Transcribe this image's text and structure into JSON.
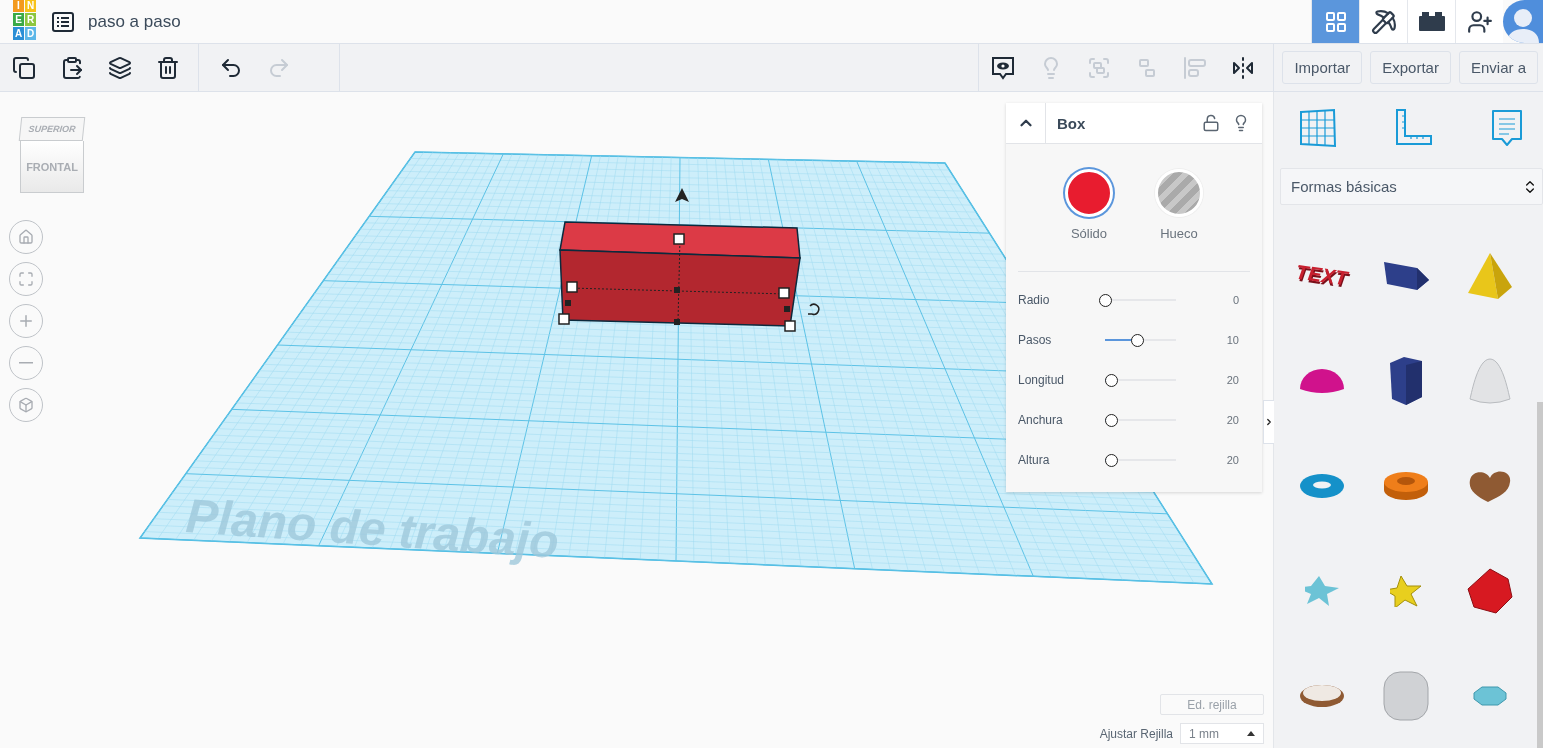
{
  "logo": {
    "letters": [
      {
        "char": "I",
        "color": "#f39a1e"
      },
      {
        "char": "N",
        "color": "#f7c21a"
      },
      {
        "char": "E",
        "color": "#3aaa47"
      },
      {
        "char": "R",
        "color": "#8dc63f"
      },
      {
        "char": "A",
        "color": "#2a8fd6"
      },
      {
        "char": "D",
        "color": "#5db7e8"
      }
    ]
  },
  "design_title": "paso a paso",
  "top_nav": [
    {
      "kind": "grid",
      "selected": true
    },
    {
      "kind": "pickaxe",
      "selected": false
    },
    {
      "kind": "bricks",
      "selected": false
    },
    {
      "kind": "add-user",
      "selected": false
    }
  ],
  "edit_tools": [
    {
      "kind": "copy",
      "disabled": false
    },
    {
      "kind": "paste",
      "disabled": false
    },
    {
      "kind": "duplicate",
      "disabled": false
    },
    {
      "kind": "delete",
      "disabled": false
    }
  ],
  "history_tools": [
    {
      "kind": "undo",
      "disabled": false
    },
    {
      "kind": "redo",
      "disabled": true
    }
  ],
  "view_tools": [
    {
      "kind": "notes",
      "disabled": false
    },
    {
      "kind": "light",
      "disabled": true
    },
    {
      "kind": "group",
      "disabled": true
    },
    {
      "kind": "ungroup",
      "disabled": true
    },
    {
      "kind": "align",
      "disabled": true
    },
    {
      "kind": "mirror",
      "disabled": false
    }
  ],
  "action_buttons": [
    "Importar",
    "Exportar",
    "Enviar a"
  ],
  "view_cube": {
    "top": "SUPERIOR",
    "front": "FRONTAL"
  },
  "nav_controls": [
    {
      "kind": "home"
    },
    {
      "kind": "fit"
    },
    {
      "kind": "zoom-in"
    },
    {
      "kind": "zoom-out"
    },
    {
      "kind": "perspective"
    }
  ],
  "workplane": {
    "label": "Plano de trabajo"
  },
  "inspector": {
    "title": "Box",
    "expanded": true,
    "locked": false,
    "materials": [
      {
        "kind": "solid",
        "label": "Sólido",
        "selected": true
      },
      {
        "kind": "hole",
        "label": "Hueco",
        "selected": false
      }
    ],
    "params": [
      {
        "name": "Radio",
        "level": 0,
        "reading": "0"
      },
      {
        "name": "Pasos",
        "level": 0.45,
        "reading": "10"
      },
      {
        "name": "Longitud",
        "level": 0.08,
        "reading": "20"
      },
      {
        "name": "Anchura",
        "level": 0.08,
        "reading": "20"
      },
      {
        "name": "Altura",
        "level": 0.08,
        "reading": "20"
      }
    ]
  },
  "grid_controls": {
    "edit_button": "Ed. rejilla",
    "snap_label": "Ajustar Rejilla",
    "snap_value": "1 mm"
  },
  "library": {
    "tabs": [
      {
        "kind": "grid",
        "selected": false
      },
      {
        "kind": "ruler",
        "selected": false
      },
      {
        "kind": "notes",
        "selected": false
      }
    ],
    "category": "Formas básicas",
    "shapes": [
      {
        "kind": "text",
        "label": "TEXT"
      },
      {
        "kind": "roof"
      },
      {
        "kind": "pyramid"
      },
      {
        "kind": "half-sphere"
      },
      {
        "kind": "polygon"
      },
      {
        "kind": "paraboloid"
      },
      {
        "kind": "torus"
      },
      {
        "kind": "tube"
      },
      {
        "kind": "heart"
      },
      {
        "kind": "star-flat"
      },
      {
        "kind": "star"
      },
      {
        "kind": "icosahedron"
      },
      {
        "kind": "ring"
      },
      {
        "kind": "rounded-cube"
      },
      {
        "kind": "gem"
      }
    ]
  }
}
